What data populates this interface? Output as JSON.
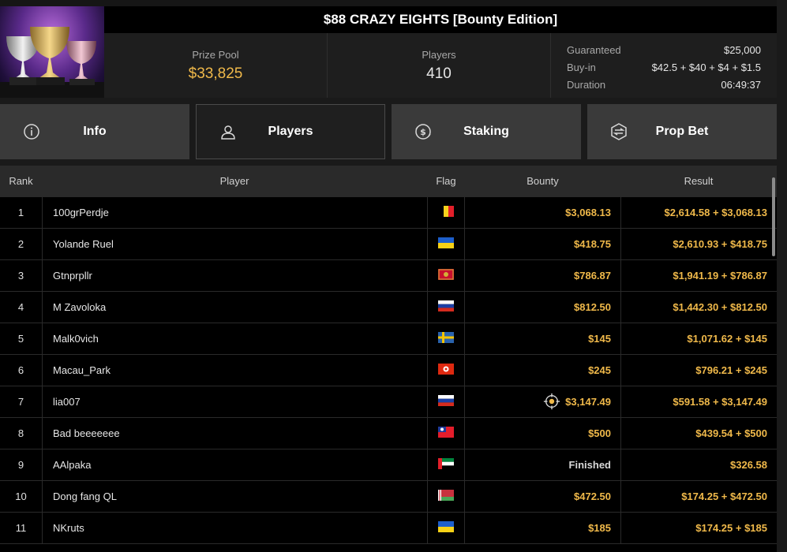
{
  "tournament": {
    "title": "$88 CRAZY EIGHTS [Bounty Edition]",
    "prize_pool_label": "Prize Pool",
    "prize_pool": "$33,825",
    "players_label": "Players",
    "players": "410",
    "details": [
      {
        "key": "Guaranteed",
        "value": "$25,000"
      },
      {
        "key": "Buy-in",
        "value": "$42.5 + $40 + $4 + $1.5"
      },
      {
        "key": "Duration",
        "value": "06:49:37"
      }
    ]
  },
  "tabs": [
    {
      "label": "Info",
      "icon": "info-icon"
    },
    {
      "label": "Players",
      "icon": "user-icon"
    },
    {
      "label": "Staking",
      "icon": "staking-icon"
    },
    {
      "label": "Prop Bet",
      "icon": "prop-bet-icon"
    }
  ],
  "active_tab": "Players",
  "table": {
    "headers": {
      "rank": "Rank",
      "player": "Player",
      "flag": "Flag",
      "bounty": "Bounty",
      "result": "Result"
    },
    "rows": [
      {
        "rank": "1",
        "player": "100grPerdje",
        "flag": "belgium",
        "bounty": "$3,068.13",
        "result": "$2,614.58 + $3,068.13"
      },
      {
        "rank": "2",
        "player": "Yolande Ruel",
        "flag": "ukraine",
        "bounty": "$418.75",
        "result": "$2,610.93 + $418.75"
      },
      {
        "rank": "3",
        "player": "Gtnprpllr",
        "flag": "montenegro",
        "bounty": "$786.87",
        "result": "$1,941.19 + $786.87"
      },
      {
        "rank": "4",
        "player": "M Zavoloka",
        "flag": "russia",
        "bounty": "$812.50",
        "result": "$1,442.30 + $812.50"
      },
      {
        "rank": "5",
        "player": "Malk0vich",
        "flag": "sweden",
        "bounty": "$145",
        "result": "$1,071.62 + $145"
      },
      {
        "rank": "6",
        "player": "Macau_Park",
        "flag": "hong-kong",
        "bounty": "$245",
        "result": "$796.21 + $245"
      },
      {
        "rank": "7",
        "player": "lia007",
        "flag": "russia",
        "bounty": "$3,147.49",
        "result": "$591.58 + $3,147.49",
        "bounty_icon": "target-icon"
      },
      {
        "rank": "8",
        "player": "Bad beeeeeee",
        "flag": "taiwan",
        "bounty": "$500",
        "result": "$439.54 + $500"
      },
      {
        "rank": "9",
        "player": "AAlpaka",
        "flag": "uae",
        "bounty": "Finished",
        "result": "$326.58"
      },
      {
        "rank": "10",
        "player": "Dong fang QL",
        "flag": "belarus",
        "bounty": "$472.50",
        "result": "$174.25 + $472.50"
      },
      {
        "rank": "11",
        "player": "NKruts",
        "flag": "ukraine",
        "bounty": "$185",
        "result": "$174.25 + $185"
      }
    ]
  },
  "colors": {
    "accent_gold": "#f0b94a",
    "background": "#000000",
    "header_bg": "#2a2a2a",
    "tab_bg": "#3a3a3a"
  }
}
